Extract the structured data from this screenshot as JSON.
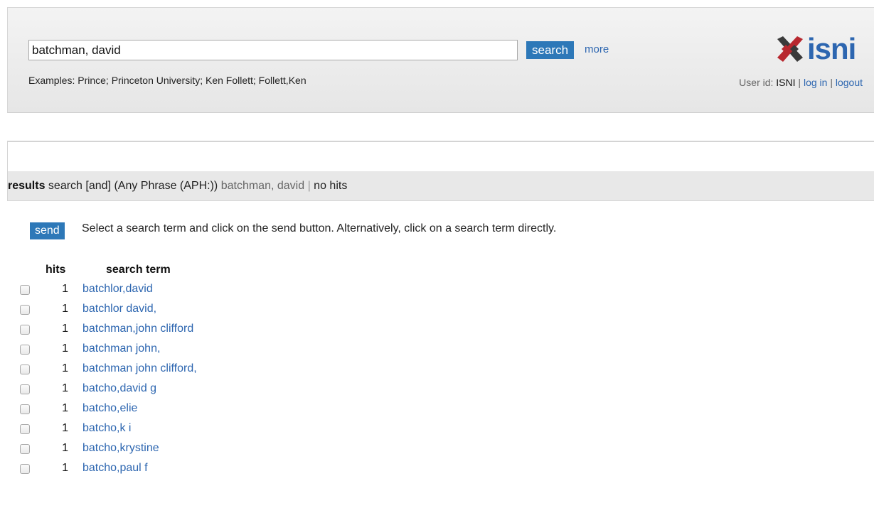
{
  "search": {
    "value": "batchman, david",
    "button_label": "search",
    "more_label": "more",
    "examples": "Examples: Prince; Princeton University; Ken Follett; Follett,Ken"
  },
  "logo": {
    "text": "isni",
    "icon": "isni-cross-logo-icon"
  },
  "user": {
    "prefix": "User id:",
    "id": "ISNI",
    "sep1": "|",
    "login": "log in",
    "sep2": "|",
    "logout": "logout"
  },
  "results": {
    "label": "results",
    "query_type": "search [and]",
    "index": "(Any Phrase (APH:))",
    "term": "batchman, david",
    "pipe": "|",
    "hits_text": "no hits"
  },
  "scan": {
    "send_label": "send",
    "instructions": "Select a search term and click on the send button. Alternatively, click on a search term directly.",
    "col_hits": "hits",
    "col_term": "search term",
    "rows": [
      {
        "hits": "1",
        "term": "batchlor,david"
      },
      {
        "hits": "1",
        "term": "batchlor david,"
      },
      {
        "hits": "1",
        "term": "batchman,john clifford"
      },
      {
        "hits": "1",
        "term": "batchman john,"
      },
      {
        "hits": "1",
        "term": "batchman john clifford,"
      },
      {
        "hits": "1",
        "term": "batcho,david g"
      },
      {
        "hits": "1",
        "term": "batcho,elie"
      },
      {
        "hits": "1",
        "term": "batcho,k i"
      },
      {
        "hits": "1",
        "term": "batcho,krystine"
      },
      {
        "hits": "1",
        "term": "batcho,paul f"
      }
    ]
  },
  "colors": {
    "accent": "#2d78b8",
    "link": "#2d66b0",
    "logo_red": "#b8282f",
    "logo_dark": "#3a3a3a"
  }
}
